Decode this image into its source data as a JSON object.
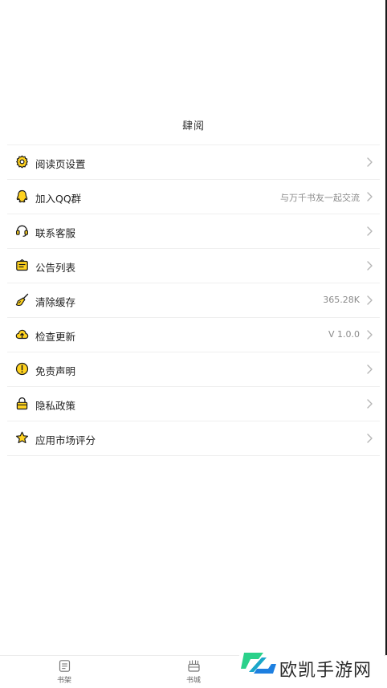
{
  "header": {
    "title": "肆阅"
  },
  "menu": {
    "items": [
      {
        "label": "阅读页设置",
        "value": "",
        "icon": "gear-icon"
      },
      {
        "label": "加入QQ群",
        "value": "与万千书友一起交流",
        "icon": "qq-icon"
      },
      {
        "label": "联系客服",
        "value": "",
        "icon": "headset-icon"
      },
      {
        "label": "公告列表",
        "value": "",
        "icon": "notice-icon"
      },
      {
        "label": "清除缓存",
        "value": "365.28K",
        "icon": "broom-icon"
      },
      {
        "label": "检查更新",
        "value": "V 1.0.0",
        "icon": "cloud-upload-icon"
      },
      {
        "label": "免责声明",
        "value": "",
        "icon": "warning-icon"
      },
      {
        "label": "隐私政策",
        "value": "",
        "icon": "lock-icon"
      },
      {
        "label": "应用市场评分",
        "value": "",
        "icon": "star-icon"
      }
    ]
  },
  "tabbar": {
    "tabs": [
      {
        "label": "书架",
        "icon": "bookshelf-icon"
      },
      {
        "label": "书城",
        "icon": "bookstore-icon"
      }
    ]
  },
  "watermark": {
    "text": "欧凯手游网"
  },
  "colors": {
    "icon_fill": "#FFD21F",
    "icon_stroke": "#1a1a1a",
    "secondary_text": "#8a8a8a",
    "divider": "#efefef",
    "watermark_green": "#2bd18a",
    "watermark_blue": "#1d7fe0"
  }
}
